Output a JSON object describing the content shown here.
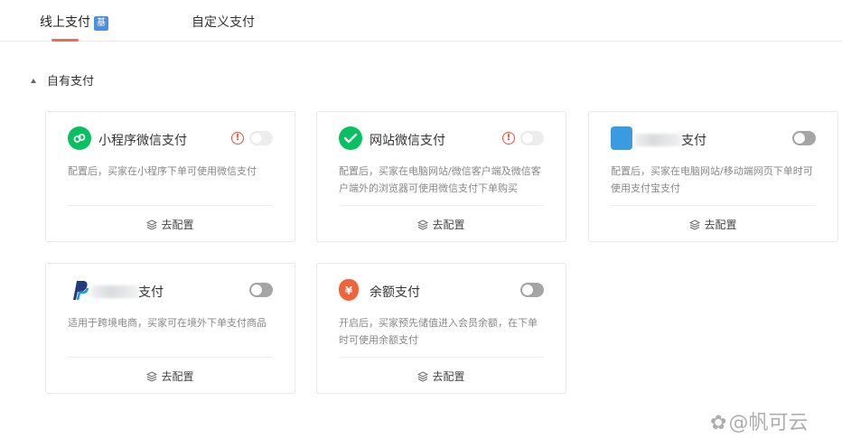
{
  "tabs": [
    {
      "label": "线上支付",
      "badge": "基",
      "active": true
    },
    {
      "label": "自定义支付",
      "active": false
    }
  ],
  "section": {
    "title": "自有支付"
  },
  "cards": [
    {
      "title": "小程序微信支付",
      "logo": "wechat-mini-program-icon",
      "warning": true,
      "toggle": "off",
      "description": "配置后，买家在小程序下单可使用微信支付",
      "config_label": "去配置"
    },
    {
      "title": "网站微信支付",
      "logo": "wechat-pay-icon",
      "warning": true,
      "toggle": "off",
      "description": "配置后，买家在电脑网站/微信客户端及微信客户端外的浏览器可使用微信支付下单购买",
      "config_label": "去配置"
    },
    {
      "title": "支付",
      "logo": "alipay-icon",
      "warning": false,
      "toggle": "off",
      "description": "配置后，买家在电脑网站/移动端网页下单时可使用支付宝支付",
      "config_label": "去配置"
    },
    {
      "title": "支付",
      "logo": "paypal-icon",
      "warning": false,
      "toggle": "off",
      "description": "适用于跨境电商，买家可在境外下单支付商品",
      "config_label": "去配置"
    },
    {
      "title": "余额支付",
      "logo": "balance-bag-icon",
      "logo_glyph": "¥",
      "warning": false,
      "toggle": "off",
      "description": "开启后，买家预先储值进入会员余额，在下单时可使用余额支付",
      "config_label": "去配置"
    }
  ],
  "watermark": "@帆可云",
  "colors": {
    "accent": "#ef6c4f",
    "wechat_green": "#07c160",
    "warning_red": "#e5533d",
    "badge_blue": "#4a90e2"
  }
}
